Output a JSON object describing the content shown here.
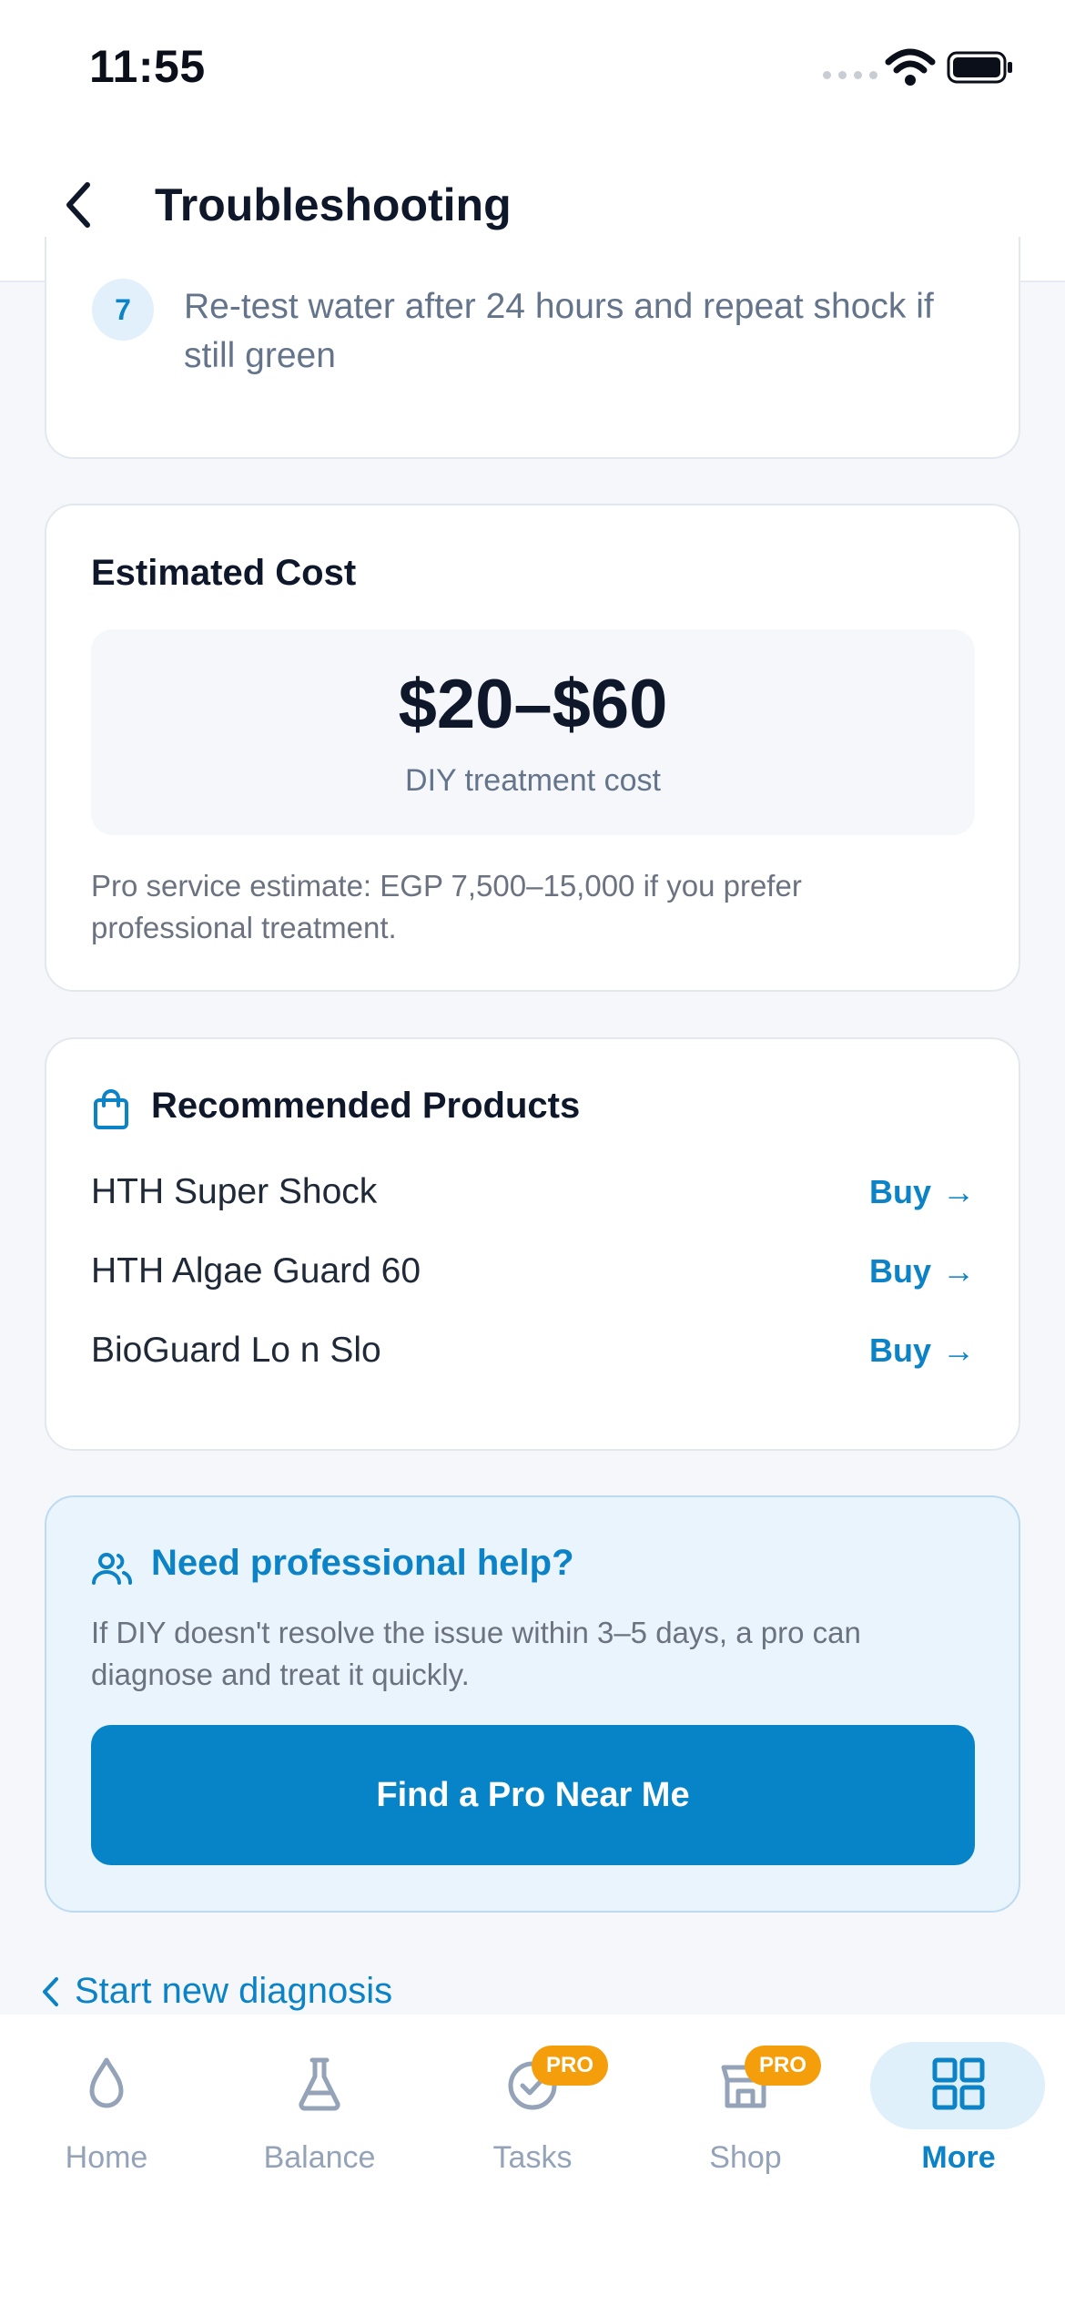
{
  "status_bar": {
    "time": "11:55"
  },
  "header": {
    "title": "Troubleshooting"
  },
  "step": {
    "number": "7",
    "text": "Re-test water after 24 hours and repeat shock if still green"
  },
  "cost": {
    "title": "Estimated Cost",
    "amount": "$20–$60",
    "subtitle": "DIY treatment cost",
    "note": "Pro service estimate: EGP 7,500–15,000 if you prefer professional treatment."
  },
  "products": {
    "title": "Recommended Products",
    "items": [
      {
        "name": "HTH Super Shock",
        "action": "Buy"
      },
      {
        "name": "HTH Algae Guard 60",
        "action": "Buy"
      },
      {
        "name": "BioGuard Lo n Slo",
        "action": "Buy"
      }
    ]
  },
  "help": {
    "title": "Need professional help?",
    "text": "If DIY doesn't resolve the issue within 3–5 days, a pro can diagnose and treat it quickly.",
    "button": "Find a Pro Near Me"
  },
  "start_new": "Start new diagnosis",
  "tabs": [
    {
      "label": "Home",
      "icon": "drop-icon"
    },
    {
      "label": "Balance",
      "icon": "flask-icon"
    },
    {
      "label": "Tasks",
      "icon": "check-circle-icon",
      "badge": "PRO"
    },
    {
      "label": "Shop",
      "icon": "store-icon",
      "badge": "PRO"
    },
    {
      "label": "More",
      "icon": "grid-icon",
      "active": true
    }
  ],
  "colors": {
    "accent": "#0784c8",
    "pro_badge": "#f59e0b"
  }
}
